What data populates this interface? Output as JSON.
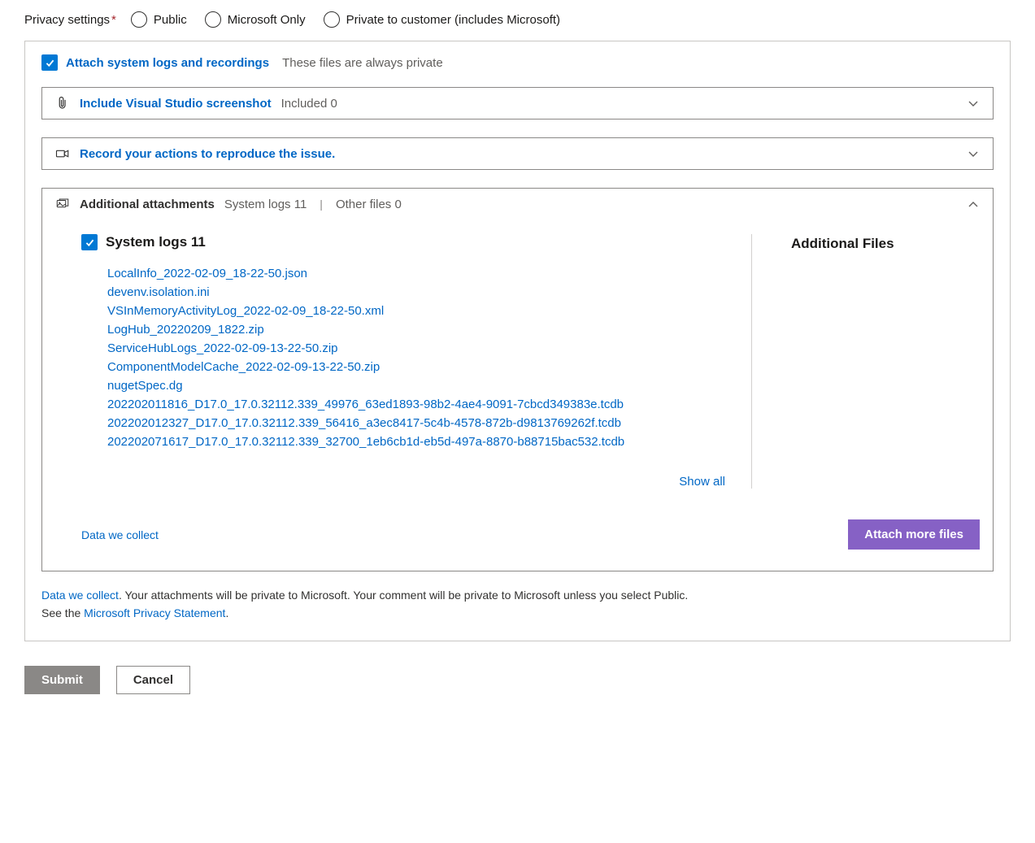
{
  "privacy": {
    "label": "Privacy settings",
    "required_marker": "*",
    "options": [
      "Public",
      "Microsoft Only",
      "Private to customer (includes Microsoft)"
    ]
  },
  "attach_toggle": {
    "label": "Attach system logs and recordings",
    "hint": "These files are always private",
    "checked": true
  },
  "panels": {
    "screenshot": {
      "title": "Include Visual Studio screenshot",
      "meta": "Included 0"
    },
    "record": {
      "title": "Record your actions to reproduce the issue."
    },
    "additional": {
      "title": "Additional attachments",
      "meta1": "System logs 11",
      "meta2": "Other files 0"
    }
  },
  "system_logs": {
    "heading": "System logs 11",
    "checked": true,
    "files": [
      "LocalInfo_2022-02-09_18-22-50.json",
      "devenv.isolation.ini",
      "VSInMemoryActivityLog_2022-02-09_18-22-50.xml",
      "LogHub_20220209_1822.zip",
      "ServiceHubLogs_2022-02-09-13-22-50.zip",
      "ComponentModelCache_2022-02-09-13-22-50.zip",
      "nugetSpec.dg",
      "202202011816_D17.0_17.0.32112.339_49976_63ed1893-98b2-4ae4-9091-7cbcd349383e.tcdb",
      "202202012327_D17.0_17.0.32112.339_56416_a3ec8417-5c4b-4578-872b-d9813769262f.tcdb",
      "202202071617_D17.0_17.0.32112.339_32700_1eb6cb1d-eb5d-497a-8870-b88715bac532.tcdb"
    ],
    "show_all": "Show all"
  },
  "additional_files_heading": "Additional Files",
  "data_we_collect": "Data we collect",
  "attach_more_btn": "Attach more files",
  "legal": {
    "link1": "Data we collect",
    "text1": ". Your attachments will be private to Microsoft. Your comment will be private to Microsoft unless you select Public.",
    "text2": "See the ",
    "link2": "Microsoft Privacy Statement",
    "text3": "."
  },
  "actions": {
    "submit": "Submit",
    "cancel": "Cancel"
  }
}
